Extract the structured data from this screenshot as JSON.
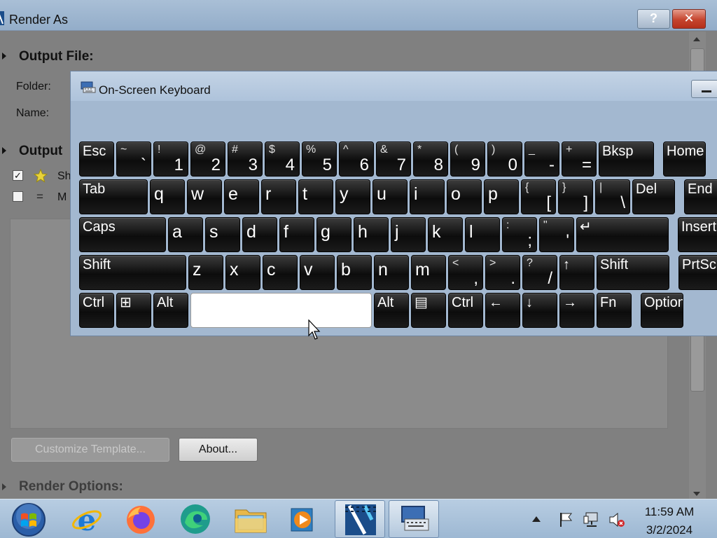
{
  "render_window": {
    "title": "Render As",
    "help_label": "?",
    "close_label": "✕",
    "output_file_heading": "Output File:",
    "folder_label": "Folder:",
    "name_label": "Name:",
    "output_format_heading": "Output",
    "row1_text": "Sh",
    "row1_checked": "✓",
    "row2_symbol": "=",
    "row2_text": "M",
    "customize_label": "Customize Template...",
    "about_label": "About...",
    "render_options_heading": "Render Options:"
  },
  "osk": {
    "title": "On-Screen Keyboard",
    "rows": [
      [
        {
          "id": "esc",
          "label": "Esc"
        },
        {
          "id": "backtick",
          "shift": "~",
          "low": "`"
        },
        {
          "id": "1",
          "shift": "!",
          "low": "1"
        },
        {
          "id": "2",
          "shift": "@",
          "low": "2"
        },
        {
          "id": "3",
          "shift": "#",
          "low": "3"
        },
        {
          "id": "4",
          "shift": "$",
          "low": "4"
        },
        {
          "id": "5",
          "shift": "%",
          "low": "5"
        },
        {
          "id": "6",
          "shift": "^",
          "low": "6"
        },
        {
          "id": "7",
          "shift": "&",
          "low": "7"
        },
        {
          "id": "8",
          "shift": "*",
          "low": "8"
        },
        {
          "id": "9",
          "shift": "(",
          "low": "9"
        },
        {
          "id": "0",
          "shift": ")",
          "low": "0"
        },
        {
          "id": "minus",
          "shift": "_",
          "low": "-"
        },
        {
          "id": "equals",
          "shift": "+",
          "low": "="
        },
        {
          "id": "bksp",
          "label": "Bksp"
        },
        {
          "id": "home",
          "label": "Home"
        }
      ],
      [
        {
          "id": "tab",
          "label": "Tab"
        },
        {
          "id": "q",
          "main": "q"
        },
        {
          "id": "w",
          "main": "w"
        },
        {
          "id": "e",
          "main": "e"
        },
        {
          "id": "r",
          "main": "r"
        },
        {
          "id": "t",
          "main": "t"
        },
        {
          "id": "y",
          "main": "y"
        },
        {
          "id": "u",
          "main": "u"
        },
        {
          "id": "i",
          "main": "i"
        },
        {
          "id": "o",
          "main": "o"
        },
        {
          "id": "p",
          "main": "p"
        },
        {
          "id": "lbracket",
          "shift": "{",
          "low": "["
        },
        {
          "id": "rbracket",
          "shift": "}",
          "low": "]"
        },
        {
          "id": "backslash",
          "shift": "|",
          "low": "\\"
        },
        {
          "id": "del",
          "label": "Del"
        },
        {
          "id": "end",
          "label": "End"
        }
      ],
      [
        {
          "id": "caps",
          "label": "Caps"
        },
        {
          "id": "a",
          "main": "a"
        },
        {
          "id": "s",
          "main": "s"
        },
        {
          "id": "d",
          "main": "d"
        },
        {
          "id": "f",
          "main": "f"
        },
        {
          "id": "g",
          "main": "g"
        },
        {
          "id": "h",
          "main": "h"
        },
        {
          "id": "j",
          "main": "j"
        },
        {
          "id": "k",
          "main": "k"
        },
        {
          "id": "l",
          "main": "l"
        },
        {
          "id": "semicolon",
          "shift": ":",
          "low": ";"
        },
        {
          "id": "quote",
          "shift": "\"",
          "low": "'"
        },
        {
          "id": "enter",
          "label": "↵"
        },
        {
          "id": "insert",
          "label": "Insert"
        }
      ],
      [
        {
          "id": "lshift",
          "label": "Shift"
        },
        {
          "id": "z",
          "main": "z"
        },
        {
          "id": "x",
          "main": "x"
        },
        {
          "id": "c",
          "main": "c"
        },
        {
          "id": "v",
          "main": "v"
        },
        {
          "id": "b",
          "main": "b"
        },
        {
          "id": "n",
          "main": "n"
        },
        {
          "id": "m",
          "main": "m"
        },
        {
          "id": "comma",
          "shift": "<",
          "low": ","
        },
        {
          "id": "period",
          "shift": ">",
          "low": "."
        },
        {
          "id": "slash",
          "shift": "?",
          "low": "/"
        },
        {
          "id": "up",
          "label": "↑"
        },
        {
          "id": "rshift",
          "label": "Shift"
        },
        {
          "id": "prtscn",
          "label": "PrtScn"
        }
      ],
      [
        {
          "id": "lctrl",
          "label": "Ctrl"
        },
        {
          "id": "win",
          "label": "⊞"
        },
        {
          "id": "lalt",
          "label": "Alt"
        },
        {
          "id": "space",
          "label": ""
        },
        {
          "id": "ralt",
          "label": "Alt"
        },
        {
          "id": "menu",
          "label": "▤"
        },
        {
          "id": "rctrl",
          "label": "Ctrl"
        },
        {
          "id": "left",
          "label": "←"
        },
        {
          "id": "down",
          "label": "↓"
        },
        {
          "id": "right",
          "label": "→"
        },
        {
          "id": "fn",
          "label": "Fn"
        },
        {
          "id": "options",
          "label": "Options"
        }
      ]
    ]
  },
  "taskbar": {
    "apps": [
      {
        "name": "start-button",
        "icon": "windows-orb-icon"
      },
      {
        "name": "taskbar-internet-explorer",
        "icon": "internet-explorer-icon"
      },
      {
        "name": "taskbar-firefox",
        "icon": "firefox-icon"
      },
      {
        "name": "taskbar-edge",
        "icon": "edge-icon"
      },
      {
        "name": "taskbar-file-explorer",
        "icon": "folder-icon"
      },
      {
        "name": "taskbar-media-player",
        "icon": "media-player-icon"
      },
      {
        "name": "taskbar-render-app",
        "icon": "render-app-icon"
      },
      {
        "name": "taskbar-on-screen-keyboard",
        "icon": "keyboard-icon"
      }
    ],
    "time": "11:59 AM",
    "date": "3/2/2024"
  }
}
